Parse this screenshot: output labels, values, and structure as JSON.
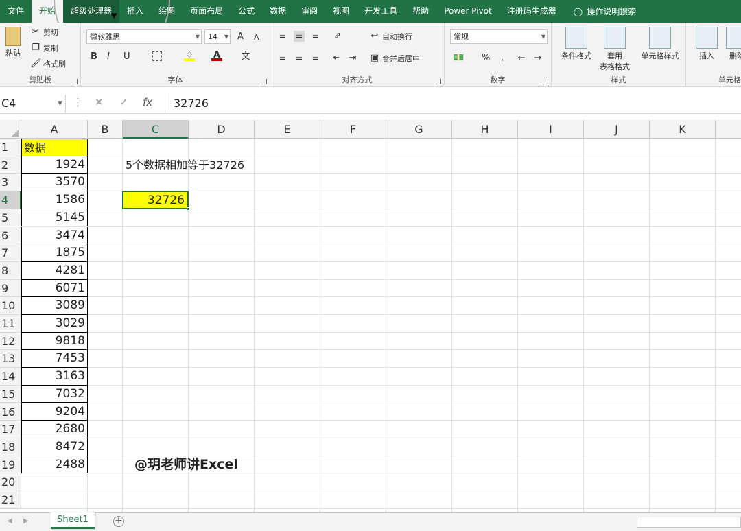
{
  "tabs": [
    "文件",
    "开始",
    "超级处理器",
    "插入",
    "绘图",
    "页面布局",
    "公式",
    "数据",
    "审阅",
    "视图",
    "开发工具",
    "帮助",
    "Power Pivot",
    "注册码生成器"
  ],
  "tell_me": "操作说明搜索",
  "clipboard": {
    "paste": "粘贴",
    "cut": "剪切",
    "copy": "复制",
    "format_painter": "格式刷",
    "label": "剪贴板"
  },
  "font": {
    "name": "微软雅黑",
    "size": "14",
    "label": "字体",
    "bold": "B",
    "italic": "I",
    "underline": "U",
    "grow": "A",
    "shrink": "A",
    "color_letter": "A"
  },
  "alignment": {
    "wrap": "自动换行",
    "merge": "合并后居中",
    "label": "对齐方式"
  },
  "number": {
    "format": "常规",
    "label": "数字",
    "percent": "%",
    "comma": ","
  },
  "styles": {
    "conditional": "条件格式",
    "table_line1": "套用",
    "table_line2": "表格格式",
    "cell_styles": "单元格样式",
    "label": "样式"
  },
  "cells": {
    "insert": "插入",
    "delete": "删除",
    "label": "单元格"
  },
  "formula_bar": {
    "name_box": "C4",
    "fx": "fx",
    "value": "32726"
  },
  "columns": [
    "A",
    "B",
    "C",
    "D",
    "E",
    "F",
    "G",
    "H",
    "I",
    "J",
    "K"
  ],
  "rows": [
    "1",
    "2",
    "3",
    "4",
    "5",
    "6",
    "7",
    "8",
    "9",
    "10",
    "11",
    "12",
    "13",
    "14",
    "15",
    "16",
    "17",
    "18",
    "19",
    "20",
    "21"
  ],
  "colA": [
    "数据",
    "1924",
    "3570",
    "1586",
    "5145",
    "3474",
    "1875",
    "4281",
    "6071",
    "3089",
    "3029",
    "9818",
    "7453",
    "3163",
    "7032",
    "9204",
    "2680",
    "8472",
    "2488"
  ],
  "note": "5个数据相加等于32726",
  "result": "32726",
  "watermark": "@玥老师讲Excel",
  "sheet": "Sheet1",
  "colors": {
    "accent": "#217346",
    "highlight": "#ffff00"
  }
}
